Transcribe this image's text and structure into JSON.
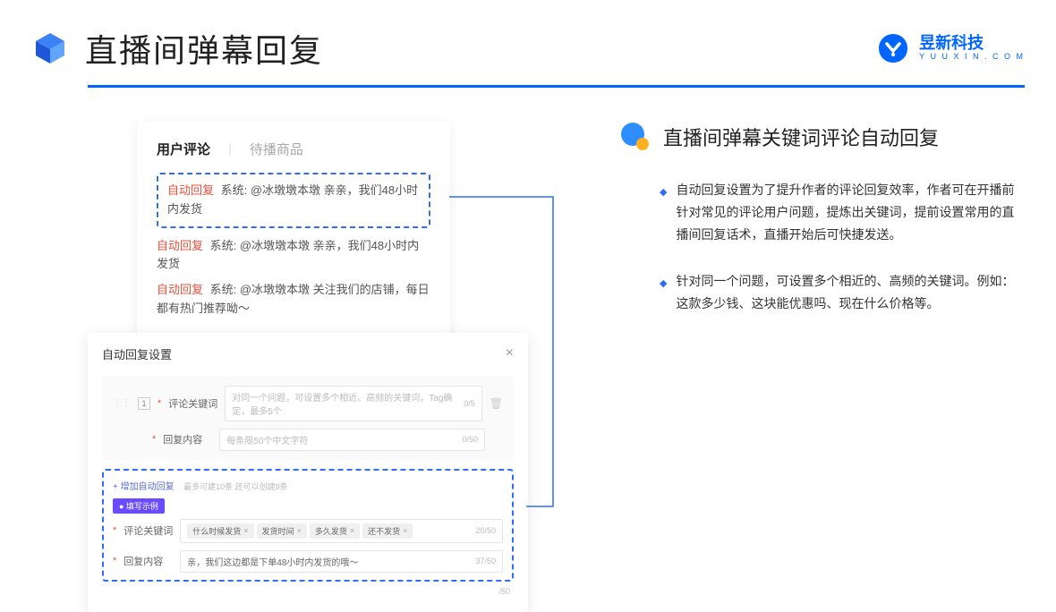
{
  "header": {
    "title": "直播间弹幕回复",
    "brand_name": "昱新科技",
    "brand_url": "Y U U X I N . C O M"
  },
  "comments": {
    "tab_active": "用户评论",
    "tab_inactive": "待播商品",
    "auto_reply_tag": "自动回复",
    "line1": "系统: @冰墩墩本墩 亲亲，我们48小时内发货",
    "line2": "系统: @冰墩墩本墩 亲亲，我们48小时内发货",
    "line3": "系统: @冰墩墩本墩 关注我们的店铺，每日都有热门推荐呦～"
  },
  "dialog": {
    "title": "自动回复设置",
    "row_num": "1",
    "label_keyword": "评论关键词",
    "placeholder_keyword": "对同一个问题，可设置多个相近、高频的关键词，Tag确定，最多5个",
    "count_kw": "0/5",
    "label_content": "回复内容",
    "placeholder_content": "每条限50个中文字符",
    "count_content": "0/50",
    "add_link": "+ 增加自动回复",
    "add_hint": "最多可建10条 还可以创建9条",
    "example_badge": "● 填写示例",
    "ex_kw_label": "评论关键词",
    "ex_tags": [
      "什么时候发货",
      "发货时间",
      "多久发货",
      "还不发货"
    ],
    "ex_kw_count": "20/50",
    "ex_content_label": "回复内容",
    "ex_content_value": "亲，我们这边都是下单48小时内发货的哦～",
    "ex_content_count": "37/50",
    "footer_count": "/50"
  },
  "right": {
    "title": "直播间弹幕关键词评论自动回复",
    "bullet1": "自动回复设置为了提升作者的评论回复效率，作者可在开播前针对常见的评论用户问题，提炼出关键词，提前设置常用的直播间回复话术，直播开始后可快捷发送。",
    "bullet2": "针对同一个问题，可设置多个相近的、高频的关键词。例如：这款多少钱、这块能优惠吗、现在什么价格等。"
  }
}
